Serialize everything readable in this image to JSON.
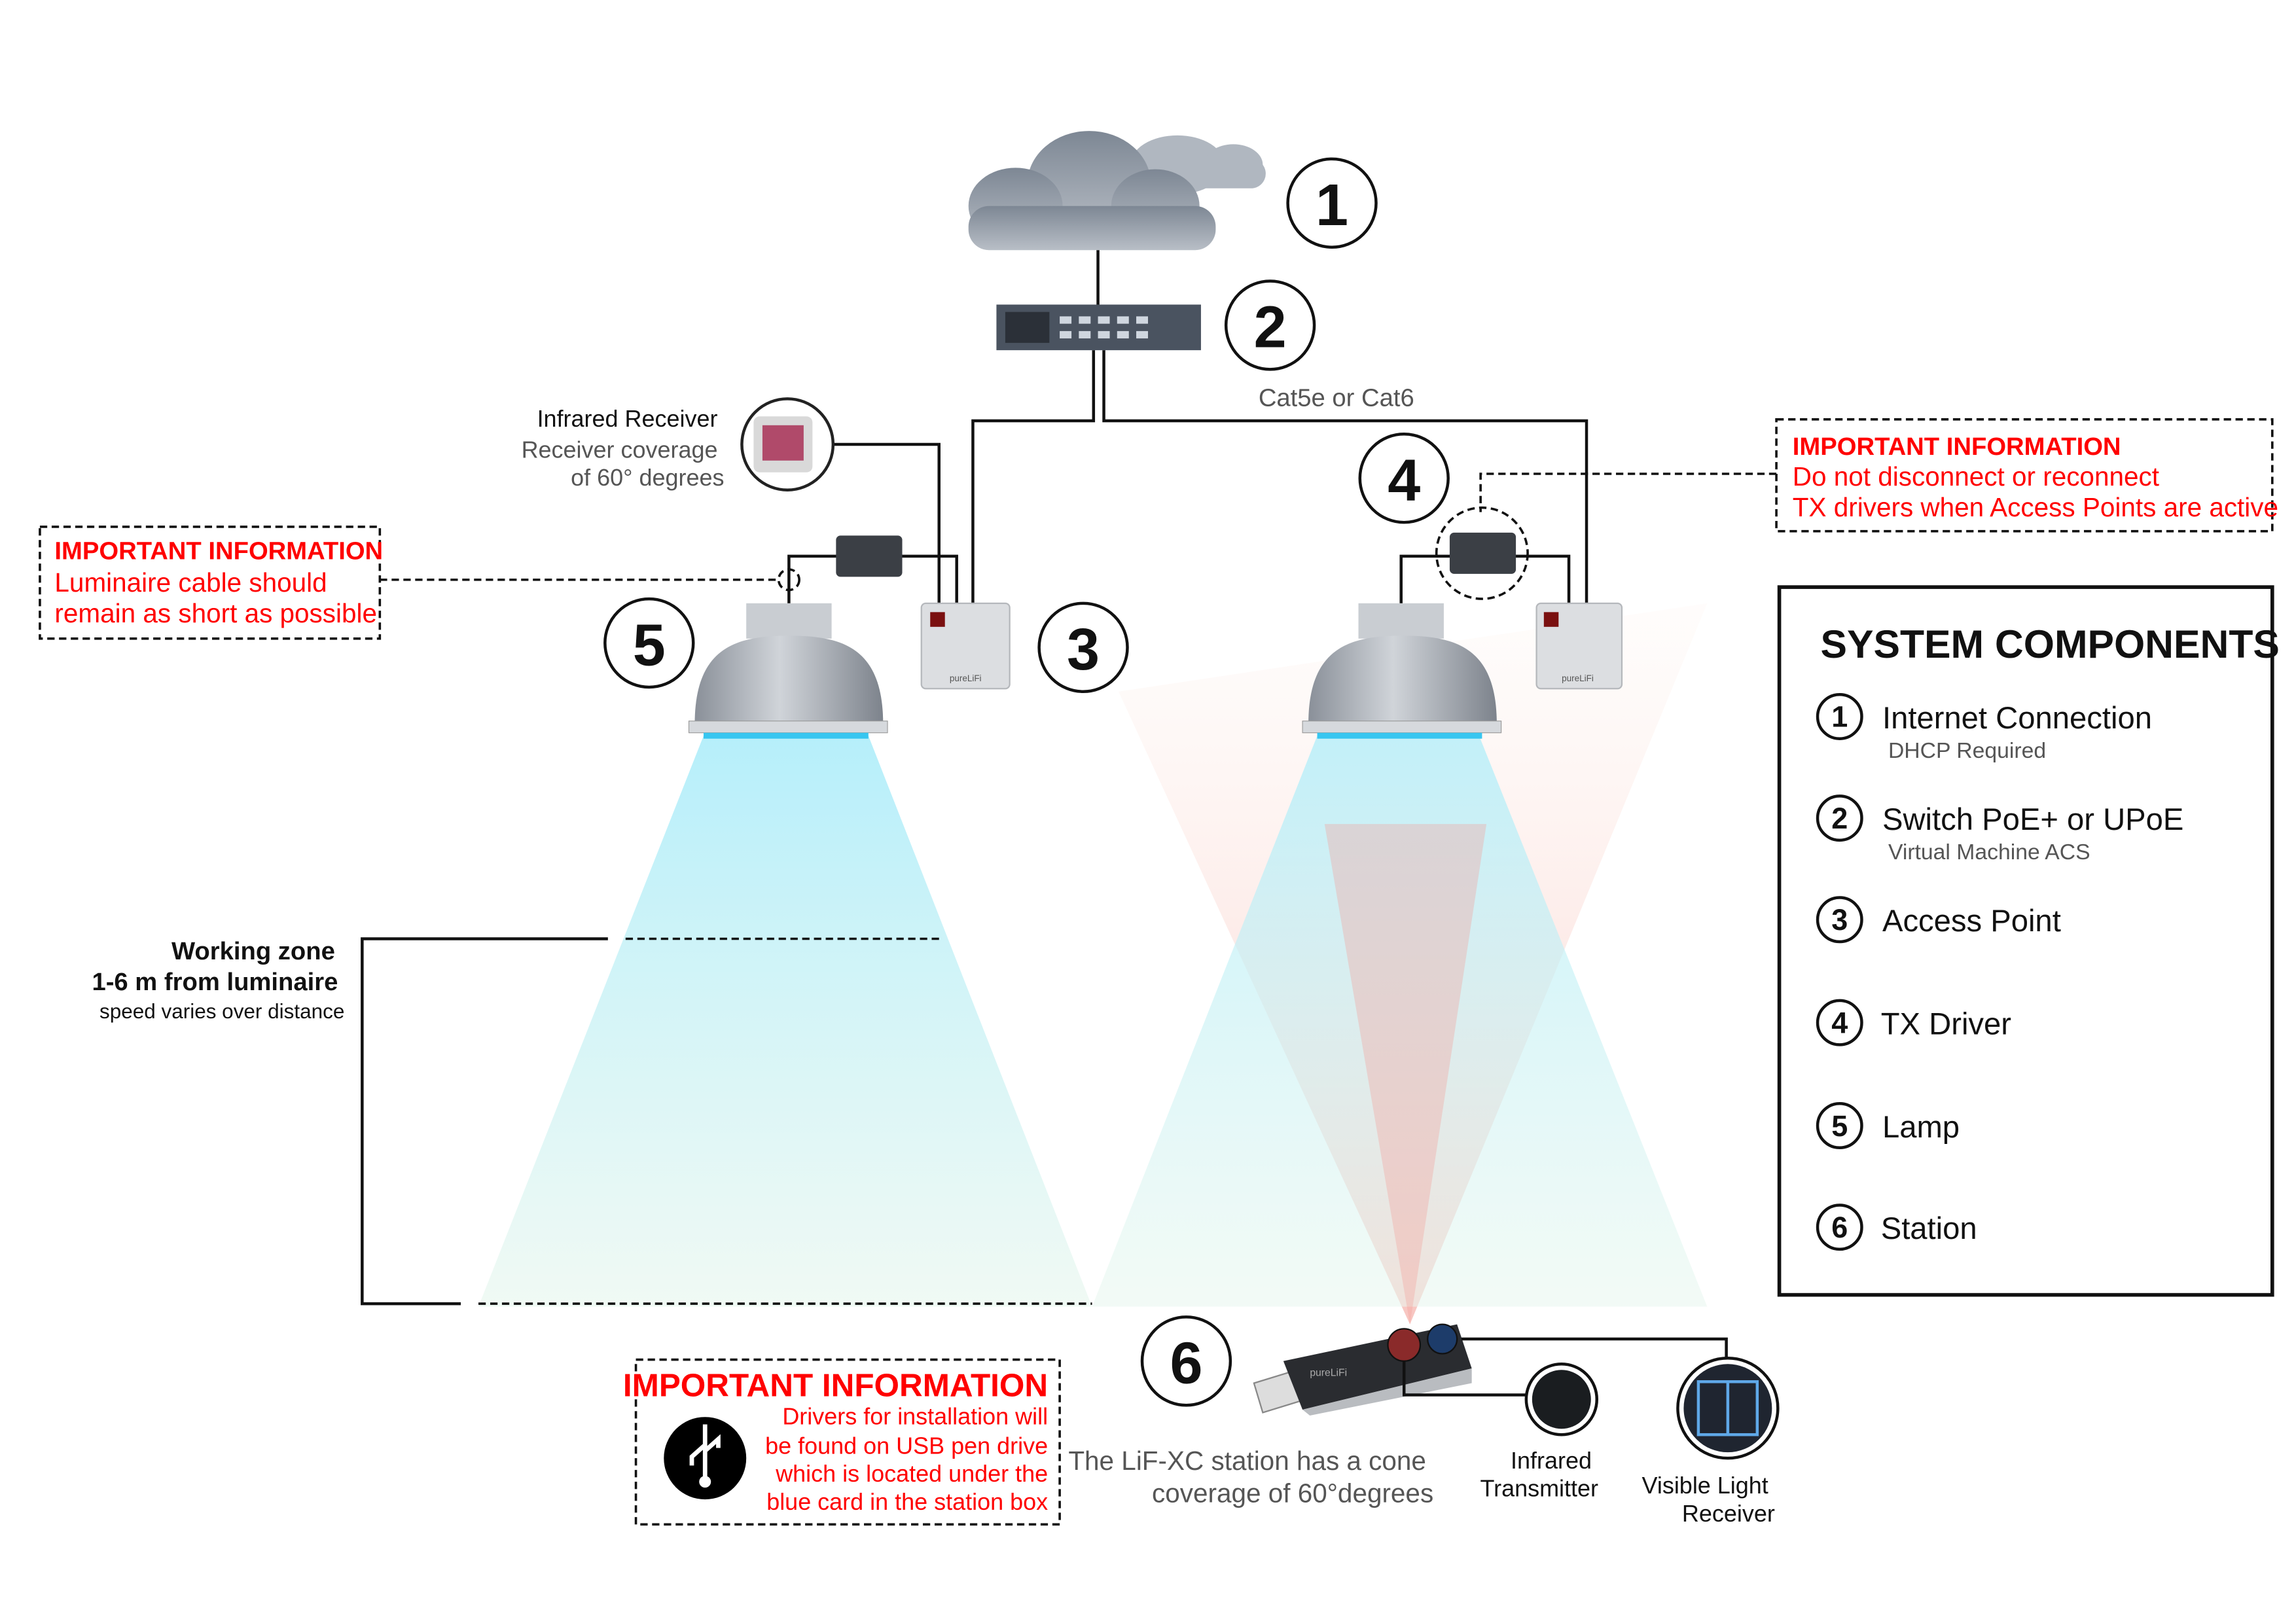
{
  "callouts": [
    "1",
    "2",
    "3",
    "4",
    "5",
    "6"
  ],
  "cable_label": "Cat5e or Cat6",
  "infrared_receiver": {
    "title": "Infrared Receiver",
    "line1": "Receiver coverage",
    "line2": "of 60° degrees"
  },
  "notice_left": {
    "title": "IMPORTANT INFORMATION",
    "line1": "Luminaire cable should",
    "line2": "remain as short as possible"
  },
  "notice_right": {
    "title": "IMPORTANT INFORMATION",
    "line1": "Do not disconnect or reconnect",
    "line2": "TX drivers when Access Points are active"
  },
  "notice_bottom": {
    "title": "IMPORTANT INFORMATION",
    "line1": "Drivers for installation will",
    "line2": "be found on USB pen drive",
    "line3": "which is located under the",
    "line4": "blue card in the station box",
    "icon": "usb-icon"
  },
  "working_zone": {
    "title": "Working zone",
    "range": "1-6 m from luminaire",
    "note": "speed varies over distance"
  },
  "access_point_brand": "pureLiFi",
  "station": {
    "brand": "pureLiFi",
    "caption1": "The LiF-XC station has a cone",
    "caption2": "coverage of 60°degrees",
    "ir_label1": "Infrared",
    "ir_label2": "Transmitter",
    "vl_label1": "Visible Light",
    "vl_label2": "Receiver"
  },
  "system_components": {
    "title": "SYSTEM COMPONENTS",
    "items": [
      {
        "num": "1",
        "label": "Internet Connection",
        "sub": "DHCP Required"
      },
      {
        "num": "2",
        "label": "Switch PoE+ or UPoE",
        "sub": "Virtual Machine ACS"
      },
      {
        "num": "3",
        "label": "Access Point",
        "sub": ""
      },
      {
        "num": "4",
        "label": "TX Driver",
        "sub": ""
      },
      {
        "num": "5",
        "label": "Lamp",
        "sub": ""
      },
      {
        "num": "6",
        "label": "Station",
        "sub": ""
      }
    ]
  },
  "colors": {
    "warning": "#ff0000",
    "light_cone": "#aeeaf5",
    "ir_cone": "#f4b0a8",
    "device": "#4a5360"
  }
}
